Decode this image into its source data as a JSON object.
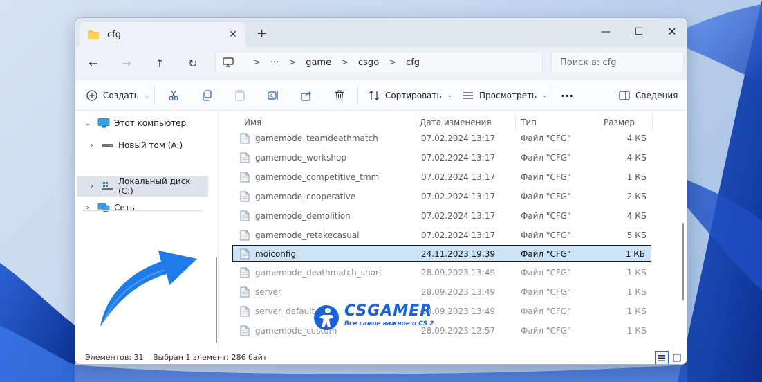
{
  "window": {
    "tab_title": "cfg",
    "tab_close": "✕",
    "new_tab": "+",
    "controls": {
      "minimize": "—",
      "maximize": "☐",
      "close": "✕"
    }
  },
  "nav": {
    "back": "←",
    "forward": "→",
    "up": "↑",
    "refresh": "↻",
    "ellipsis": "···",
    "breadcrumb": [
      "game",
      "csgo",
      "cfg"
    ],
    "separator": ">",
    "search_placeholder": "Поиск в: cfg"
  },
  "toolbar": {
    "create_label": "Создать",
    "sort_label": "Сортировать",
    "view_label": "Просмотреть",
    "more": "···",
    "details_label": "Сведения"
  },
  "sidebar": {
    "items": [
      {
        "label": "Этот компьютер",
        "chevron": "⌄",
        "icon": "monitor-icon"
      },
      {
        "label": "Новый том (A:)",
        "chevron": "›",
        "icon": "drive-icon"
      },
      {
        "label": "Локальный диск (C:)",
        "chevron": "›",
        "icon": "windows-drive-icon"
      },
      {
        "label": "Сеть",
        "chevron": "›",
        "icon": "network-icon"
      }
    ]
  },
  "columns": {
    "name": "Имя",
    "date": "Дата изменения",
    "type": "Тип",
    "size": "Размер"
  },
  "files": [
    {
      "name": "gamemode_teamdeathmatch",
      "date": "07.02.2024 13:17",
      "type": "Файл \"CFG\"",
      "size": "4 КБ"
    },
    {
      "name": "gamemode_workshop",
      "date": "07.02.2024 13:17",
      "type": "Файл \"CFG\"",
      "size": "4 КБ"
    },
    {
      "name": "gamemode_competitive_tmm",
      "date": "07.02.2024 13:17",
      "type": "Файл \"CFG\"",
      "size": "1 КБ"
    },
    {
      "name": "gamemode_cooperative",
      "date": "07.02.2024 13:17",
      "type": "Файл \"CFG\"",
      "size": "2 КБ"
    },
    {
      "name": "gamemode_demolition",
      "date": "07.02.2024 13:17",
      "type": "Файл \"CFG\"",
      "size": "4 КБ"
    },
    {
      "name": "gamemode_retakecasual",
      "date": "07.02.2024 13:17",
      "type": "Файл \"CFG\"",
      "size": "5 КБ"
    },
    {
      "name": "moiconfig",
      "date": "24.11.2023 19:39",
      "type": "Файл \"CFG\"",
      "size": "1 КБ"
    },
    {
      "name": "gamemode_deathmatch_short",
      "date": "28.09.2023 13:49",
      "type": "Файл \"CFG\"",
      "size": "1 КБ"
    },
    {
      "name": "server",
      "date": "28.09.2023 13:49",
      "type": "Файл \"CFG\"",
      "size": "1 КБ"
    },
    {
      "name": "server_default",
      "date": "28.09.2023 13:49",
      "type": "Файл \"CFG\"",
      "size": "1 КБ"
    },
    {
      "name": "gamemode_custom",
      "date": "28.09.2023 12:57",
      "type": "Файл \"CFG\"",
      "size": "1 КБ"
    }
  ],
  "status": {
    "items_count": "Элементов: 31",
    "selected": "Выбран 1 элемент: 286 байт"
  },
  "watermark": {
    "title": "CSGAMER",
    "subtitle": "Все самое важное о CS 2"
  },
  "colors": {
    "accent": "#1f6fc5",
    "selection_bg": "#cce4f7",
    "folder": "#f4c542",
    "watermark": "#1a62d9"
  }
}
